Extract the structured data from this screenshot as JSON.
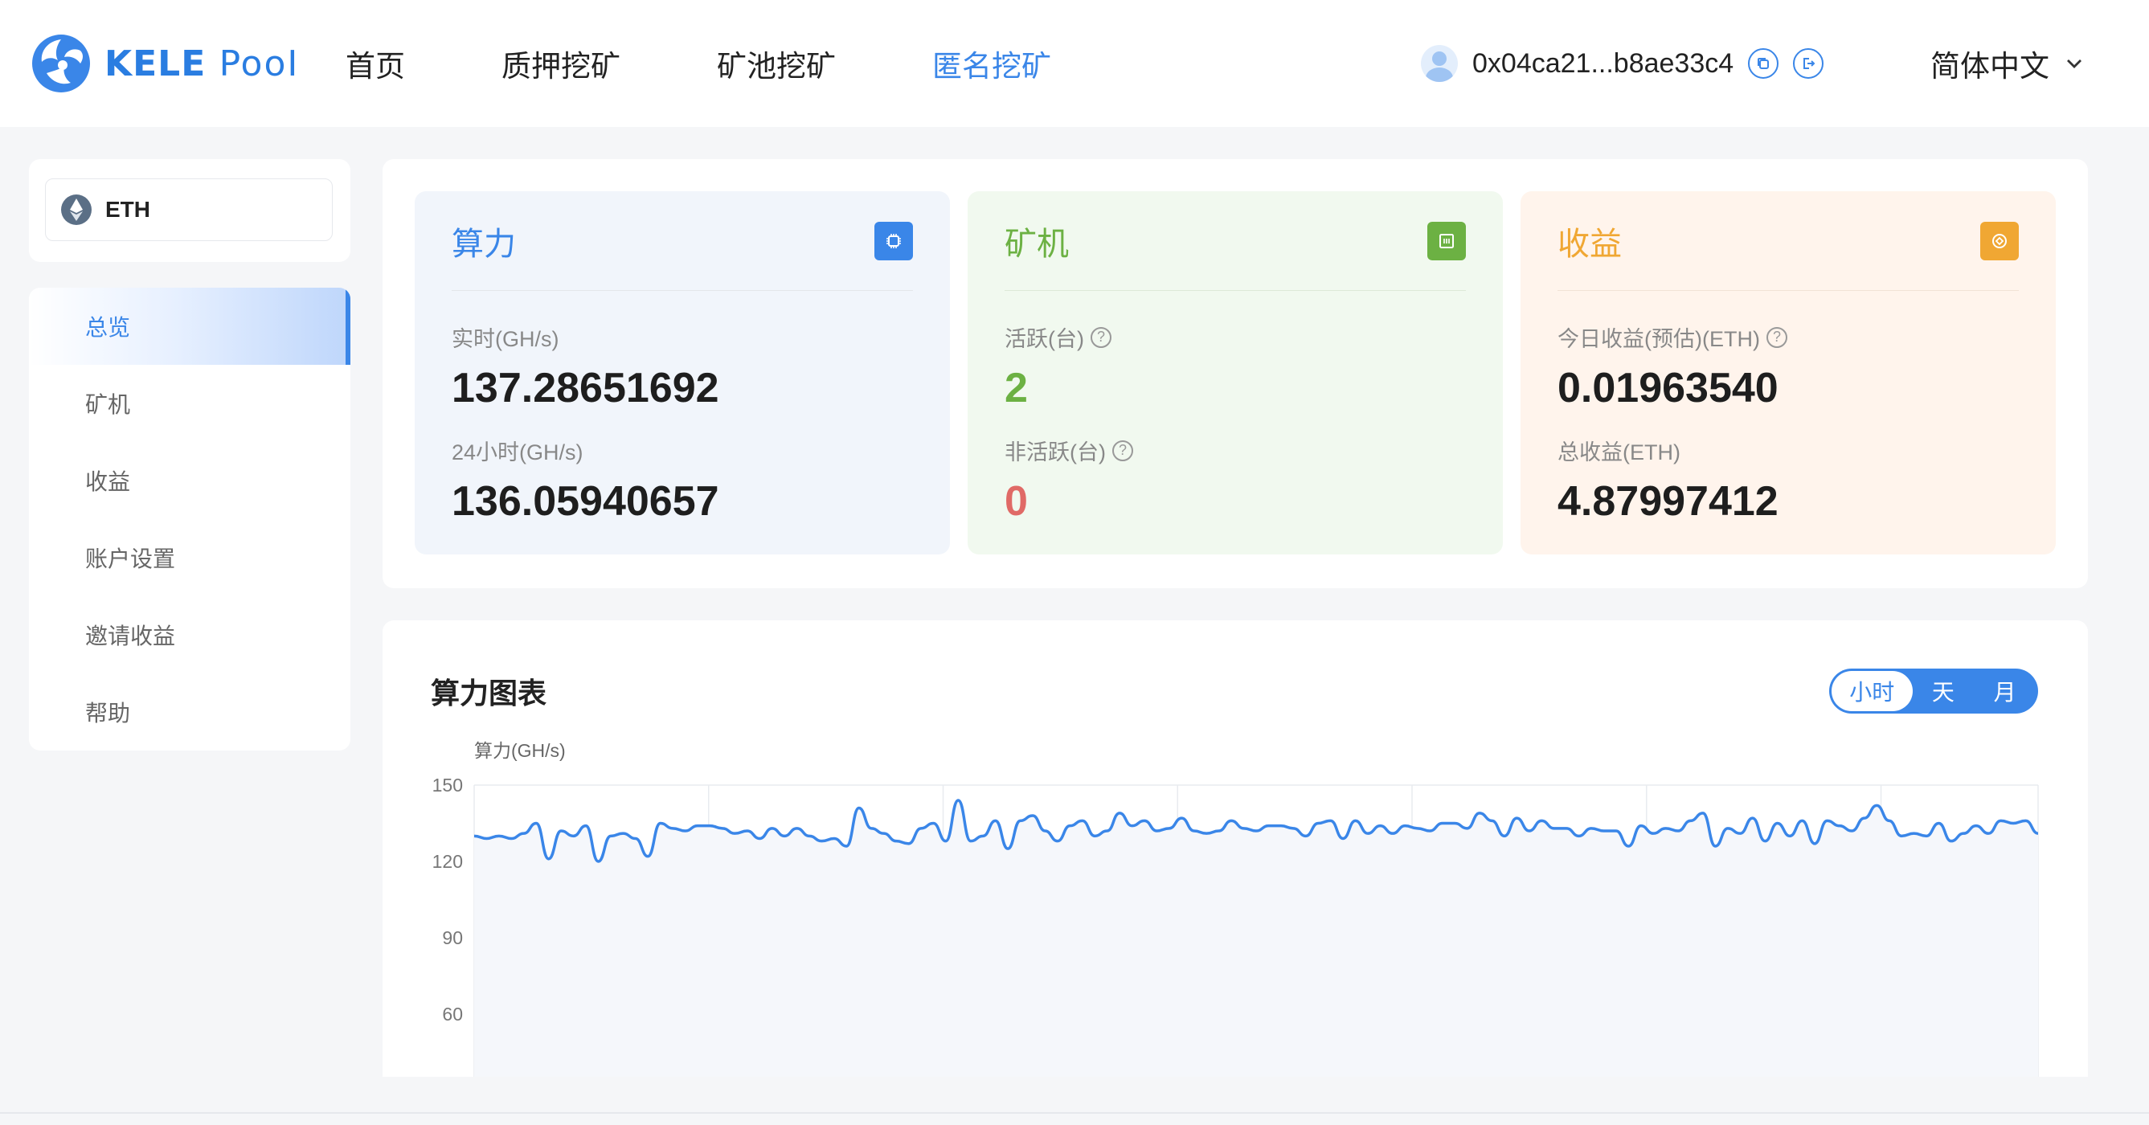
{
  "header": {
    "logo_text_1": "KELE",
    "logo_text_2": "PooI",
    "nav": [
      "首页",
      "质押挖矿",
      "矿池挖矿",
      "匿名挖矿"
    ],
    "active_nav": 3,
    "address": "0x04ca21...b8ae33c4",
    "language": "简体中文"
  },
  "sidebar": {
    "coin": "ETH",
    "menu": [
      "总览",
      "矿机",
      "收益",
      "账户设置",
      "邀请收益",
      "帮助"
    ],
    "active_menu": 0
  },
  "cards": {
    "hashrate": {
      "title": "算力",
      "label1": "实时(GH/s)",
      "value1": "137.28651692",
      "label2": "24小时(GH/s)",
      "value2": "136.05940657"
    },
    "miners": {
      "title": "矿机",
      "label1": "活跃(台)",
      "value1": "2",
      "label2": "非活跃(台)",
      "value2": "0"
    },
    "earnings": {
      "title": "收益",
      "label1": "今日收益(预估)(ETH)",
      "value1": "0.01963540",
      "label2": "总收益(ETH)",
      "value2": "4.87997412"
    }
  },
  "chart": {
    "title": "算力图表",
    "toggle": [
      "小时",
      "天",
      "月"
    ],
    "active_toggle": 0
  },
  "colors": {
    "accent": "#3a86e8",
    "green": "#6cb143",
    "orange": "#f0a733",
    "red": "#e06a66"
  },
  "chart_data": {
    "type": "line",
    "title": "",
    "ylabel": "算力(GH/s)",
    "xlabel": "",
    "ylim": [
      40,
      150
    ],
    "yticks": [
      150,
      120,
      90,
      60
    ],
    "grid": true,
    "series": [
      {
        "values": [
          130,
          129,
          130,
          129,
          131,
          135,
          121,
          132,
          130,
          134,
          120,
          130,
          131,
          129,
          122,
          135,
          133,
          132,
          134,
          134,
          133,
          131,
          132,
          129,
          133,
          130,
          133,
          130,
          128,
          129,
          126,
          141,
          133,
          131,
          128,
          127,
          133,
          135,
          128,
          144,
          128,
          130,
          136,
          125,
          136,
          138,
          132,
          128,
          134,
          136,
          130,
          132,
          139,
          134,
          136,
          132,
          133,
          137,
          132,
          131,
          132,
          136,
          133,
          132,
          134,
          134,
          133,
          130,
          135,
          136,
          129,
          136,
          131,
          134,
          131,
          134,
          133,
          132,
          135,
          135,
          133,
          139,
          136,
          130,
          137,
          132,
          136,
          133,
          133,
          130,
          133,
          132,
          132,
          126,
          134,
          131,
          133,
          132,
          136,
          139,
          126,
          133,
          131,
          137,
          128,
          135,
          130,
          136,
          127,
          136,
          134,
          132,
          137,
          142,
          136,
          130,
          131,
          130,
          135,
          128,
          131,
          134,
          131,
          136,
          135,
          136,
          131
        ]
      }
    ]
  }
}
